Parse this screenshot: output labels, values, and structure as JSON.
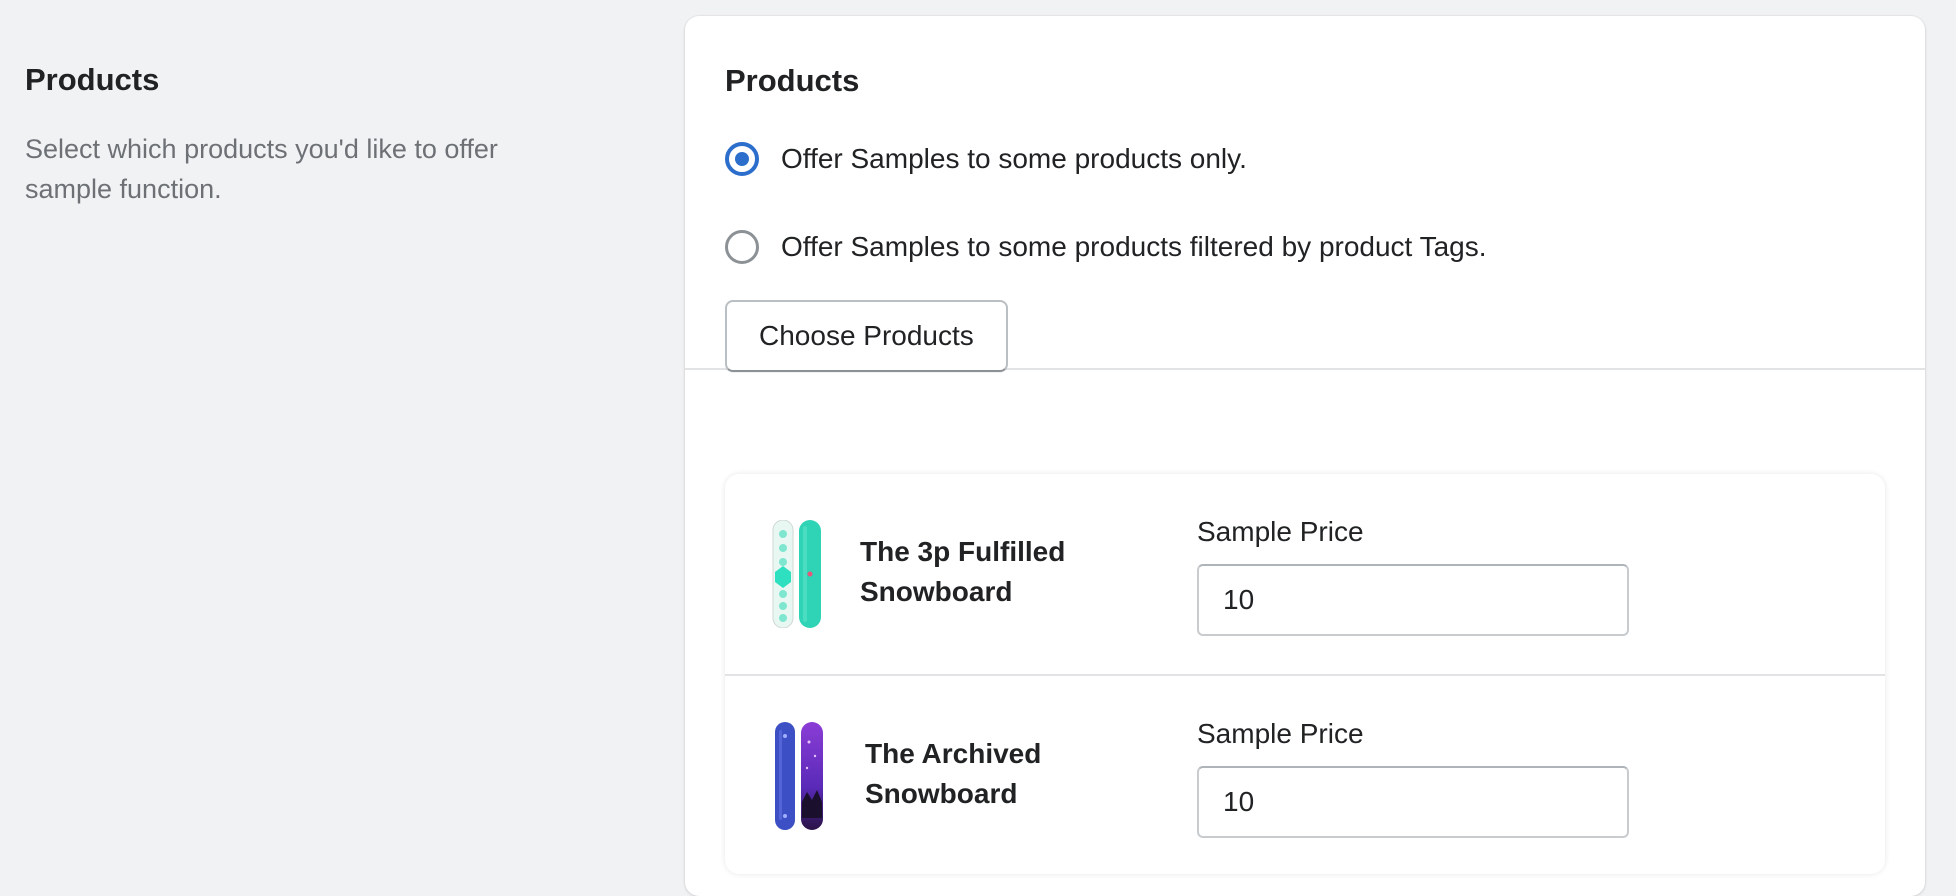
{
  "aside": {
    "title": "Products",
    "description": "Select which products you'd like to offer sample function."
  },
  "card": {
    "title": "Products",
    "options": [
      {
        "label": "Offer Samples to some products only.",
        "checked": true
      },
      {
        "label": "Offer Samples to some products filtered by product Tags.",
        "checked": false
      }
    ],
    "choose_button": "Choose Products"
  },
  "products": [
    {
      "name": "The 3p Fulfilled Snowboard",
      "price_label": "Sample Price",
      "price_value": "10",
      "thumb_icon": "snowboard-teal-icon"
    },
    {
      "name": "The Archived Snowboard",
      "price_label": "Sample Price",
      "price_value": "10",
      "thumb_icon": "snowboard-purple-icon"
    }
  ],
  "colors": {
    "accent": "#2c6ecb",
    "page_bg": "#f1f2f4",
    "muted_text": "#6d7175"
  }
}
